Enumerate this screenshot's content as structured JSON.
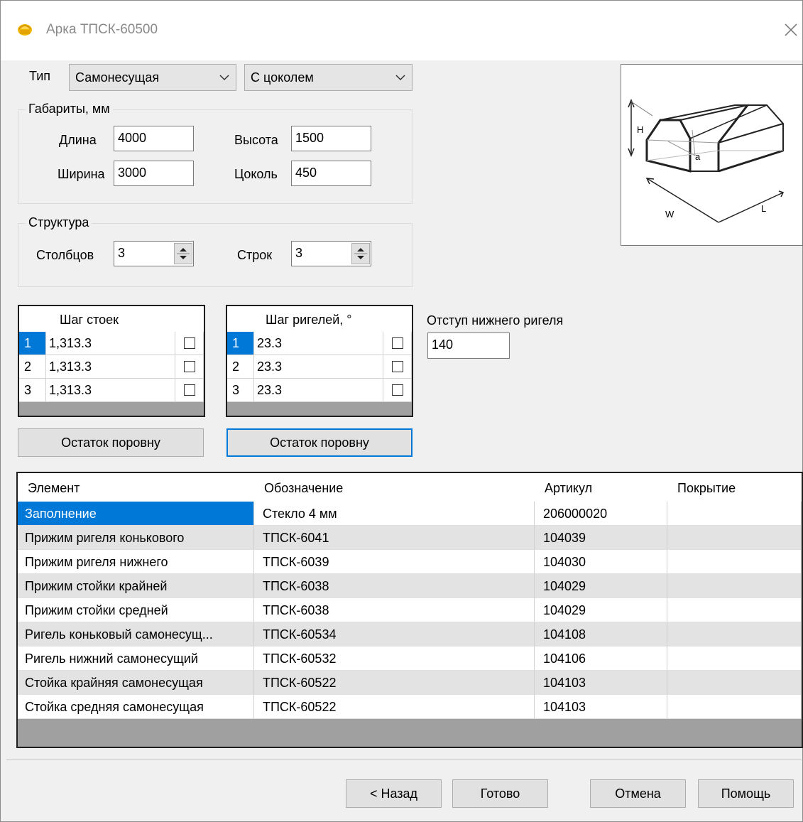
{
  "window": {
    "title": "Арка ТПСК-60500"
  },
  "type_row": {
    "label": "Тип",
    "type_value": "Самонесущая",
    "variant_value": "С цоколем"
  },
  "dims": {
    "legend": "Габариты, мм",
    "length_label": "Длина",
    "length_value": "4000",
    "height_label": "Высота",
    "height_value": "1500",
    "width_label": "Ширина",
    "width_value": "3000",
    "plinth_label": "Цоколь",
    "plinth_value": "450"
  },
  "structure": {
    "legend": "Структура",
    "columns_label": "Столбцов",
    "columns_value": "3",
    "rows_label": "Строк",
    "rows_value": "3"
  },
  "post_grid": {
    "header": "Шаг стоек",
    "rows": [
      {
        "num": "1",
        "value": "1,313.3"
      },
      {
        "num": "2",
        "value": "1,313.3"
      },
      {
        "num": "3",
        "value": "1,313.3"
      }
    ],
    "button": "Остаток поровну"
  },
  "rail_grid": {
    "header": "Шаг ригелей, °",
    "rows": [
      {
        "num": "1",
        "value": "23.3"
      },
      {
        "num": "2",
        "value": "23.3"
      },
      {
        "num": "3",
        "value": "23.3"
      }
    ],
    "button": "Остаток поровну"
  },
  "offset": {
    "label": "Отступ нижнего ригеля",
    "value": "140"
  },
  "diagram": {
    "h": "H",
    "a": "a",
    "w": "W",
    "l": "L"
  },
  "elements": {
    "columns": [
      "Элемент",
      "Обозначение",
      "Артикул",
      "Покрытие"
    ],
    "rows": [
      {
        "element": "Заполнение",
        "designation": "Стекло 4 мм",
        "article": "206000020",
        "coating": ""
      },
      {
        "element": "Прижим ригеля конькового",
        "designation": "ТПСК-6041",
        "article": "104039",
        "coating": ""
      },
      {
        "element": "Прижим ригеля нижнего",
        "designation": "ТПСК-6039",
        "article": "104030",
        "coating": ""
      },
      {
        "element": "Прижим стойки крайней",
        "designation": "ТПСК-6038",
        "article": "104029",
        "coating": ""
      },
      {
        "element": "Прижим стойки средней",
        "designation": "ТПСК-6038",
        "article": "104029",
        "coating": ""
      },
      {
        "element": "Ригель коньковый самонесущ...",
        "designation": "ТПСК-60534",
        "article": "104108",
        "coating": ""
      },
      {
        "element": "Ригель нижний самонесущий",
        "designation": "ТПСК-60532",
        "article": "104106",
        "coating": ""
      },
      {
        "element": "Стойка крайняя самонесущая",
        "designation": "ТПСК-60522",
        "article": "104103",
        "coating": ""
      },
      {
        "element": "Стойка средняя самонесущая",
        "designation": "ТПСК-60522",
        "article": "104103",
        "coating": ""
      }
    ]
  },
  "footer": {
    "back": "< Назад",
    "finish": "Готово",
    "cancel": "Отмена",
    "help": "Помощь"
  },
  "colors": {
    "selection": "#0078d7",
    "alt_row": "#e3e3e3",
    "dialog_bg": "#f0f0f0"
  }
}
